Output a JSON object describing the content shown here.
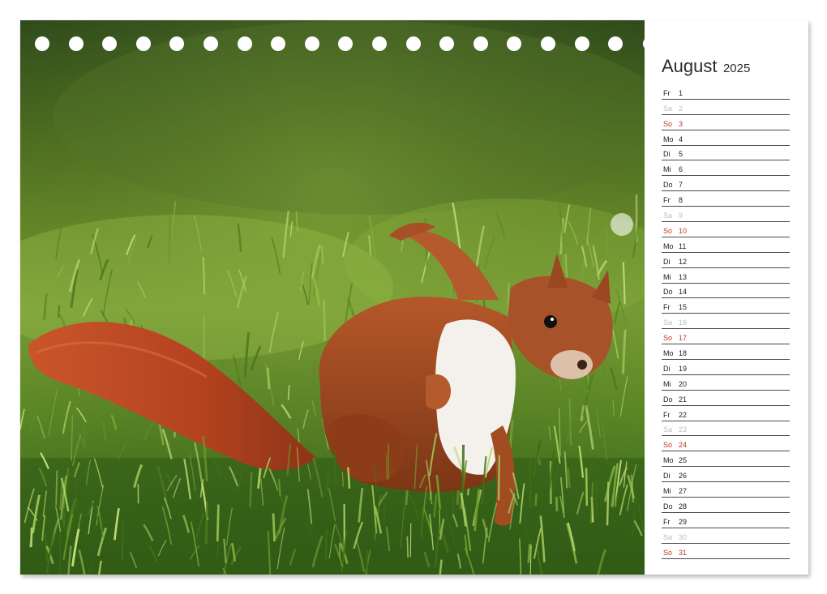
{
  "calendar": {
    "month": "August",
    "year": "2025",
    "days": [
      {
        "weekday": "Fr",
        "day": "1",
        "type": "weekday"
      },
      {
        "weekday": "Sa",
        "day": "2",
        "type": "saturday"
      },
      {
        "weekday": "So",
        "day": "3",
        "type": "sunday"
      },
      {
        "weekday": "Mo",
        "day": "4",
        "type": "weekday"
      },
      {
        "weekday": "Di",
        "day": "5",
        "type": "weekday"
      },
      {
        "weekday": "Mi",
        "day": "6",
        "type": "weekday"
      },
      {
        "weekday": "Do",
        "day": "7",
        "type": "weekday"
      },
      {
        "weekday": "Fr",
        "day": "8",
        "type": "weekday"
      },
      {
        "weekday": "Sa",
        "day": "9",
        "type": "saturday"
      },
      {
        "weekday": "So",
        "day": "10",
        "type": "sunday"
      },
      {
        "weekday": "Mo",
        "day": "11",
        "type": "weekday"
      },
      {
        "weekday": "Di",
        "day": "12",
        "type": "weekday"
      },
      {
        "weekday": "Mi",
        "day": "13",
        "type": "weekday"
      },
      {
        "weekday": "Do",
        "day": "14",
        "type": "weekday"
      },
      {
        "weekday": "Fr",
        "day": "15",
        "type": "weekday"
      },
      {
        "weekday": "Sa",
        "day": "16",
        "type": "saturday"
      },
      {
        "weekday": "So",
        "day": "17",
        "type": "sunday"
      },
      {
        "weekday": "Mo",
        "day": "18",
        "type": "weekday"
      },
      {
        "weekday": "Di",
        "day": "19",
        "type": "weekday"
      },
      {
        "weekday": "Mi",
        "day": "20",
        "type": "weekday"
      },
      {
        "weekday": "Do",
        "day": "21",
        "type": "weekday"
      },
      {
        "weekday": "Fr",
        "day": "22",
        "type": "weekday"
      },
      {
        "weekday": "Sa",
        "day": "23",
        "type": "saturday"
      },
      {
        "weekday": "So",
        "day": "24",
        "type": "sunday"
      },
      {
        "weekday": "Mo",
        "day": "25",
        "type": "weekday"
      },
      {
        "weekday": "Di",
        "day": "26",
        "type": "weekday"
      },
      {
        "weekday": "Mi",
        "day": "27",
        "type": "weekday"
      },
      {
        "weekday": "Do",
        "day": "28",
        "type": "weekday"
      },
      {
        "weekday": "Fr",
        "day": "29",
        "type": "weekday"
      },
      {
        "weekday": "Sa",
        "day": "30",
        "type": "saturday"
      },
      {
        "weekday": "So",
        "day": "31",
        "type": "sunday"
      }
    ]
  },
  "binding": {
    "hole_count": 23,
    "photo_side_holes": 18
  },
  "colors": {
    "sunday": "#c0392b",
    "saturday": "#bdbdbd",
    "text": "#222222",
    "rule": "#4a4a4a",
    "hole_on_photo": "#ffffff",
    "hole_outline": "#555555"
  },
  "photo": {
    "subject": "squirrel-photo"
  }
}
